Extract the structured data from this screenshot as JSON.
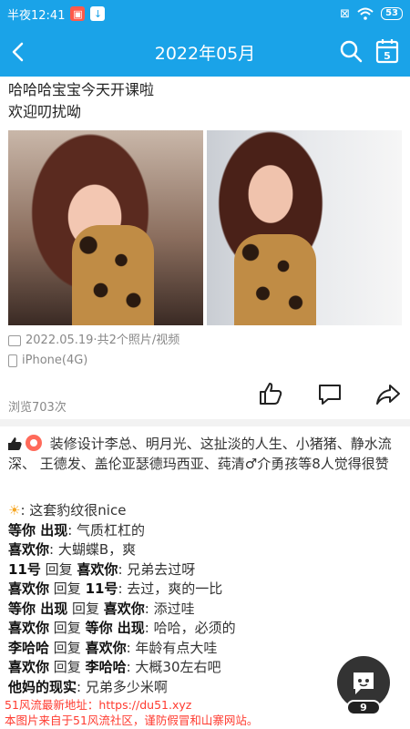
{
  "status": {
    "time": "半夜12:41",
    "battery": "53"
  },
  "nav": {
    "title": "2022年05月",
    "calendar_day": "5"
  },
  "post": {
    "text_line1": "哈哈哈宝宝今天开课啦",
    "text_line2": "欢迎叨扰呦",
    "date_info": "2022.05.19·共2个照片/视频",
    "device": "iPhone(4G)",
    "views": "浏览703次"
  },
  "likes": {
    "text": "装修设计李总、明月光、这扯淡的人生、小猪猪、静水流深、 王德发、盖伦亚瑟德玛西亚、莼清♂介勇孩等8人觉得很赞"
  },
  "comments": [
    {
      "prefix": "☀",
      "name": "",
      "mid": "",
      "to": "",
      "text": ": 这套豹纹很nice"
    },
    {
      "prefix": "",
      "name": "等你 出现",
      "mid": "",
      "to": "",
      "text": ": 气质杠杠的"
    },
    {
      "prefix": "",
      "name": "喜欢你",
      "mid": "",
      "to": "",
      "text": ": 大蝴蝶B，爽"
    },
    {
      "prefix": "",
      "name": "11号",
      "mid": " 回复 ",
      "to": "喜欢你",
      "text": ": 兄弟去过呀"
    },
    {
      "prefix": "",
      "name": "喜欢你",
      "mid": " 回复 ",
      "to": "11号",
      "text": ": 去过，爽的一比"
    },
    {
      "prefix": "",
      "name": "等你 出现",
      "mid": " 回复 ",
      "to": "喜欢你",
      "text": ": 添过哇"
    },
    {
      "prefix": "",
      "name": "喜欢你",
      "mid": " 回复 ",
      "to": "等你 出现",
      "text": ": 哈哈，必须的"
    },
    {
      "prefix": "",
      "name": "李哈哈",
      "mid": " 回复 ",
      "to": "喜欢你",
      "text": ": 年龄有点大哇"
    },
    {
      "prefix": "",
      "name": "喜欢你",
      "mid": " 回复 ",
      "to": "李哈哈",
      "text": ": 大概30左右吧"
    },
    {
      "prefix": "",
      "name": "他妈的现实",
      "mid": "",
      "to": "",
      "text": ": 兄弟多少米啊"
    }
  ],
  "watermark": {
    "line1": "51风流最新地址：https://du51.xyz",
    "line2": "本图片来自于51风流社区，谨防假冒和山寨网站。"
  },
  "fab": {
    "badge": "9"
  },
  "colors": {
    "primary": "#1aa3e8",
    "watermark": "#ff3b30"
  }
}
